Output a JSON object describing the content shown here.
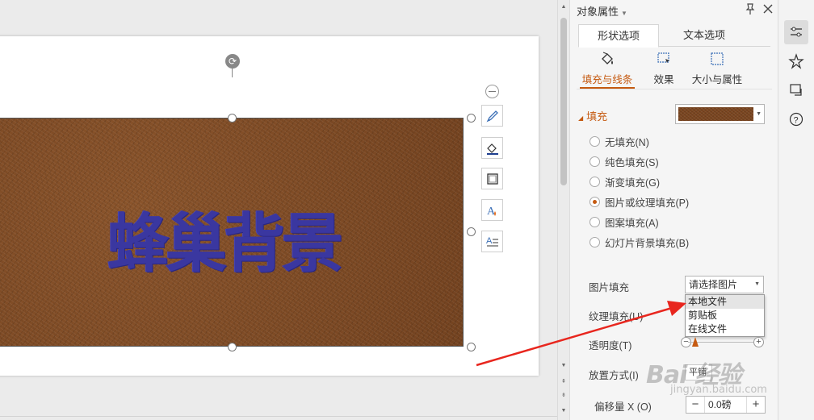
{
  "canvas": {
    "shape_text": "蜂巢背景"
  },
  "panel": {
    "title": "对象属性",
    "tabs": [
      "形状选项",
      "文本选项"
    ],
    "subtabs": [
      "填充与线条",
      "效果",
      "大小与属性"
    ],
    "fill_section_label": "填充",
    "fill_options": [
      {
        "label": "无填充(N)",
        "checked": false
      },
      {
        "label": "纯色填充(S)",
        "checked": false
      },
      {
        "label": "渐变填充(G)",
        "checked": false
      },
      {
        "label": "图片或纹理填充(P)",
        "checked": true
      },
      {
        "label": "图案填充(A)",
        "checked": false
      },
      {
        "label": "幻灯片背景填充(B)",
        "checked": false
      }
    ],
    "picture_fill_label": "图片填充",
    "picture_fill_value": "请选择图片",
    "picture_fill_menu": [
      "本地文件",
      "剪贴板",
      "在线文件"
    ],
    "texture_fill_label": "纹理填充(U)",
    "transparency_label": "透明度(T)",
    "transparency_value": 0.1,
    "placement_label": "放置方式(I)",
    "placement_value": "平铺",
    "offset_x_label": "偏移量 X (O)",
    "offset_x_value": "0.0磅"
  },
  "watermark": {
    "logo": "Bai 经验",
    "url": "jingyan.baidu.com"
  },
  "colors": {
    "accent": "#c55a11",
    "shape_text": "#3a37a0",
    "leather": "#7e4a24",
    "annotation_arrow": "#e8261e"
  }
}
